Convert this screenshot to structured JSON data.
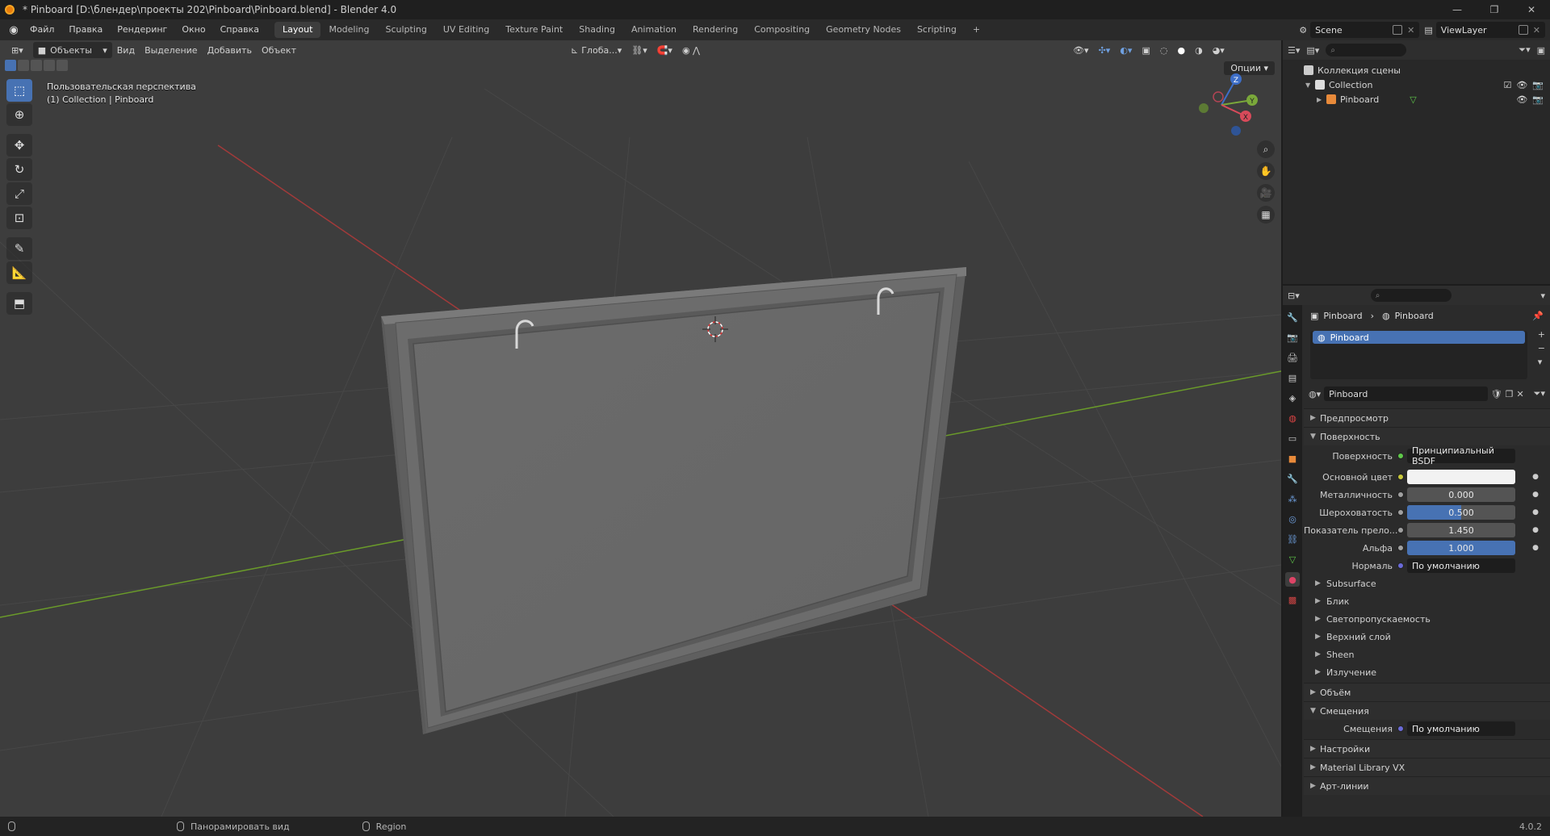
{
  "window": {
    "title": "* Pinboard [D:\\блендер\\проекты 202\\Pinboard\\Pinboard.blend] - Blender 4.0"
  },
  "menu": [
    "Файл",
    "Правка",
    "Рендеринг",
    "Окно",
    "Справка"
  ],
  "workspaces": [
    "Layout",
    "Modeling",
    "Sculpting",
    "UV Editing",
    "Texture Paint",
    "Shading",
    "Animation",
    "Rendering",
    "Compositing",
    "Geometry Nodes",
    "Scripting"
  ],
  "active_workspace": "Layout",
  "scene": {
    "name": "Scene",
    "view_layer": "ViewLayer"
  },
  "viewport": {
    "mode": "Объекты",
    "menus": [
      "Вид",
      "Выделение",
      "Добавить",
      "Объект"
    ],
    "transform_orientation": "Глоба...",
    "options_label": "Опции",
    "info_line1": "Пользовательская перспектива",
    "info_line2": "(1) Collection | Pinboard",
    "gizmo": {
      "x": "X",
      "y": "Y",
      "z": "Z"
    }
  },
  "outliner": {
    "scene_collection": "Коллекция сцены",
    "collection": "Collection",
    "object": "Pinboard"
  },
  "properties": {
    "breadcrumb_object": "Pinboard",
    "breadcrumb_material": "Pinboard",
    "slot": "Pinboard",
    "material_name": "Pinboard",
    "panels": {
      "preview": "Предпросмотр",
      "surface": "Поверхность",
      "volume": "Объём",
      "displacement": "Смещения",
      "settings": "Настройки",
      "material_library": "Material Library VX",
      "lineart": "Арт-линии"
    },
    "surface_rows": [
      {
        "label": "Поверхность",
        "value": "Принципиальный BSDF"
      },
      {
        "label": "Основной цвет",
        "value": ""
      },
      {
        "label": "Металличность",
        "value": "0.000"
      },
      {
        "label": "Шероховатость",
        "value": "0.500"
      },
      {
        "label": "Показатель прело...",
        "value": "1.450"
      },
      {
        "label": "Альфа",
        "value": "1.000"
      },
      {
        "label": "Нормаль",
        "value": "По умолчанию"
      }
    ],
    "sub_panels": [
      "Subsurface",
      "Блик",
      "Светопропускаемость",
      "Верхний слой",
      "Sheen",
      "Излучение"
    ],
    "displacement_row": {
      "label": "Смещения",
      "value": "По умолчанию"
    },
    "roughness_fraction": 0.5
  },
  "statusbar": {
    "pan_view": "Панорамировать вид",
    "region": "Region",
    "version": "4.0.2"
  },
  "colors": {
    "accent": "#4772b3",
    "viewport_bg": "#3d3d3d",
    "x_axis": "#a13a3a",
    "y_axis": "#6a9a2a",
    "object_gray": "#6f6f6f"
  }
}
